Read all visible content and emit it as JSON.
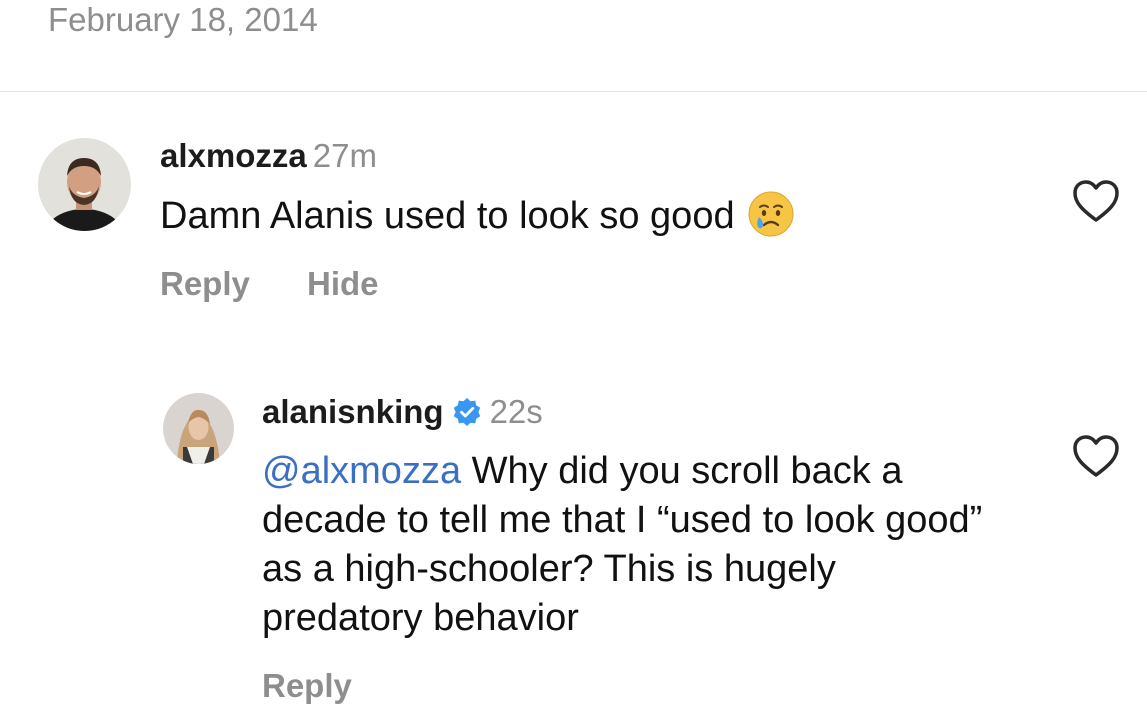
{
  "post": {
    "date": "February 18, 2014"
  },
  "comments": [
    {
      "username": "alxmozza",
      "time": "27m",
      "text": "Damn Alanis used to look so good",
      "emoji": "crying-face",
      "actions": [
        "Reply",
        "Hide"
      ]
    },
    {
      "username": "alanisnking",
      "verified": true,
      "time": "22s",
      "mention": "@alxmozza",
      "text": " Why did you scroll back a decade to tell me that I “used to look good” as a high-schooler? This is hugely predatory behavior",
      "actions": [
        "Reply"
      ]
    }
  ],
  "icons": {
    "like": "heart-outline-icon",
    "verified": "verified-badge-icon"
  },
  "colors": {
    "muted": "#8e8e8e",
    "mention": "#3b6fc4",
    "verified": "#3897f0",
    "text": "#111111"
  }
}
